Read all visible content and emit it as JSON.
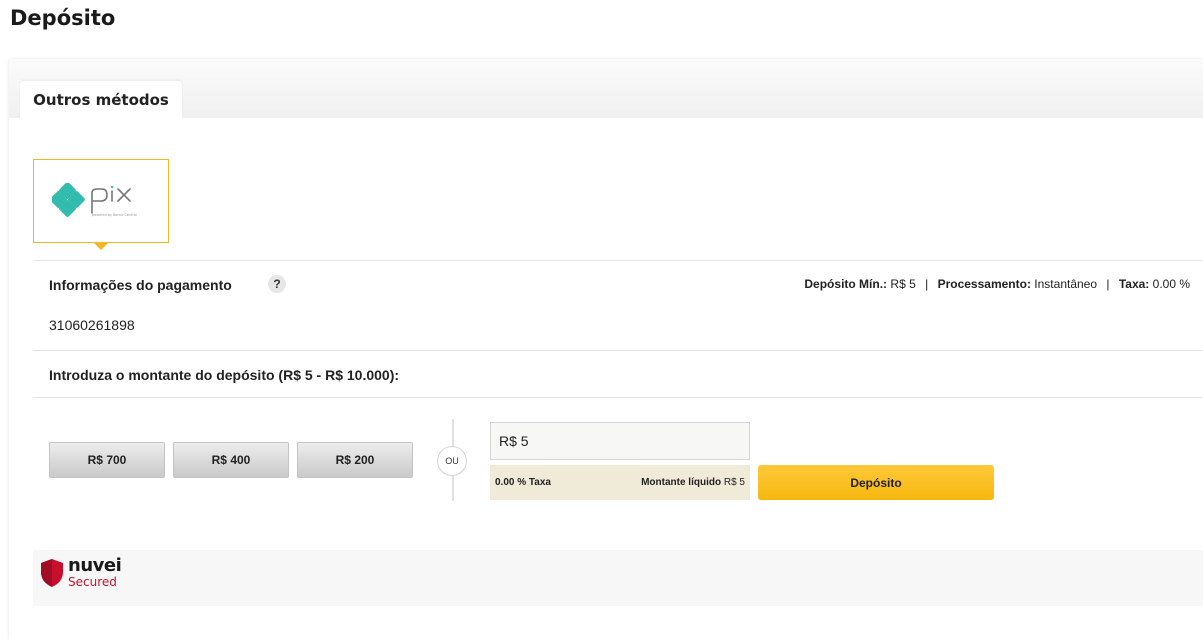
{
  "page": {
    "title": "Depósito"
  },
  "tabs": [
    {
      "label": "Outros métodos",
      "active": true
    }
  ],
  "payment_method": {
    "name": "pix",
    "icon": "pix-logo-icon",
    "brand_color": "#32bcad",
    "subtitle": "powered by Banco Central"
  },
  "payment_info": {
    "label": "Informações do pagamento",
    "help": "?",
    "min_deposit_label": "Depósito Mín.:",
    "min_deposit_value": "R$ 5",
    "processing_label": "Processamento:",
    "processing_value": "Instantâneo",
    "fee_label": "Taxa:",
    "fee_value": "0.00 %",
    "separator": "|",
    "account_number": "31060261898"
  },
  "amount": {
    "prompt": "Introduza o montante do depósito (R$ 5 - R$ 10.000):",
    "quick_buttons": [
      "R$ 700",
      "R$ 400",
      "R$ 200"
    ],
    "or_label": "OU",
    "input_value": "R$ 5",
    "fee_text": "0.00 % Taxa",
    "net_label": "Montante líquido",
    "net_value": "R$ 5",
    "deposit_button": "Depósito"
  },
  "security": {
    "brand": "nuvei",
    "secured": "Secured",
    "icon": "shield-icon",
    "color": "#c8102e"
  },
  "colors": {
    "accent": "#f6b80e",
    "selected_border": "#f1b823",
    "fee_bg": "#f0ead9"
  }
}
